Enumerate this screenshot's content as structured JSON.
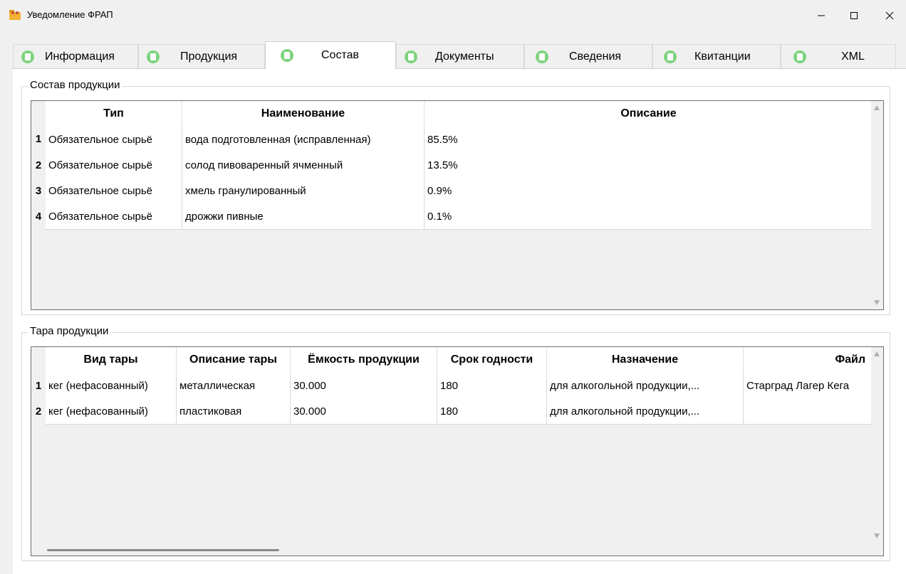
{
  "window": {
    "title": "Уведомление ФРАП",
    "icon": "app-folder-icon",
    "controls": [
      "minimize-icon",
      "maximize-icon",
      "close-icon"
    ]
  },
  "tabs": [
    {
      "label": "Информация",
      "active": false
    },
    {
      "label": "Продукция",
      "active": false
    },
    {
      "label": "Состав",
      "active": true
    },
    {
      "label": "Документы",
      "active": false
    },
    {
      "label": "Сведения",
      "active": false
    },
    {
      "label": "Квитанции",
      "active": false
    },
    {
      "label": "XML",
      "active": false
    }
  ],
  "composition": {
    "group_title": "Состав продукции",
    "columns": [
      "Тип",
      "Наименование",
      "Описание"
    ],
    "rows": [
      {
        "num": "1",
        "type": "Обязательное сырьё",
        "name": "вода подготовленная (исправленная)",
        "desc": "85.5%"
      },
      {
        "num": "2",
        "type": "Обязательное сырьё",
        "name": "солод пивоваренный ячменный",
        "desc": "13.5%"
      },
      {
        "num": "3",
        "type": "Обязательное сырьё",
        "name": "хмель гранулированный",
        "desc": "0.9%"
      },
      {
        "num": "4",
        "type": "Обязательное сырьё",
        "name": "дрожжи пивные",
        "desc": "0.1%"
      }
    ]
  },
  "packaging": {
    "group_title": "Тара продукции",
    "columns": [
      "Вид тары",
      "Описание тары",
      "Ёмкость продукции",
      "Срок годности",
      "Назначение",
      "Файл"
    ],
    "rows": [
      {
        "num": "1",
        "kind": "кег (нефасованный)",
        "desc": "металлическая",
        "capacity": "30.000",
        "shelf": "180",
        "purpose": "для алкогольной продукции,...",
        "file": "Старград Лагер Кега"
      },
      {
        "num": "2",
        "kind": "кег (нефасованный)",
        "desc": "пластиковая",
        "capacity": "30.000",
        "shelf": "180",
        "purpose": "для алкогольной продукции,...",
        "file": ""
      }
    ]
  },
  "colors": {
    "tab_icon_green": "#7ed37e",
    "window_bg": "#f0f0f0",
    "panel_bg": "#ffffff"
  }
}
